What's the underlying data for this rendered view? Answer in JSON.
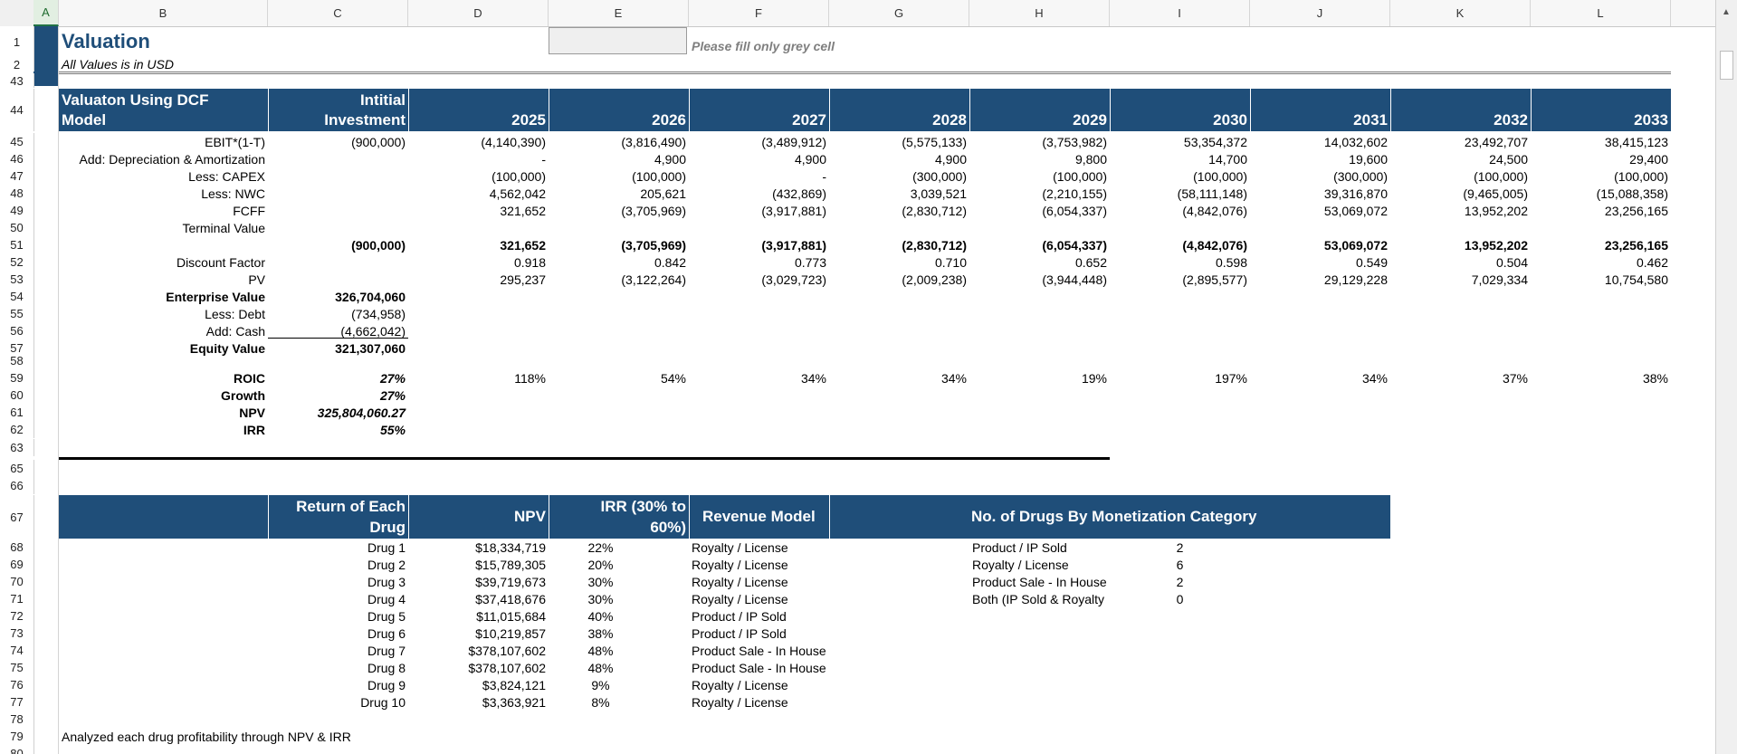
{
  "spreadsheet": {
    "columns": [
      "A",
      "B",
      "C",
      "D",
      "E",
      "F",
      "G",
      "H",
      "I",
      "J",
      "K",
      "L"
    ],
    "selected_column": "A",
    "title": "Valuation",
    "subtitle": "All Values is in USD",
    "note": "Please fill only grey cell",
    "dcf_header": {
      "label_line1": "Valuaton Using DCF",
      "label_line2": "Model",
      "initial_line1": "Intitial",
      "initial_line2": "Investment",
      "years": [
        "2025",
        "2026",
        "2027",
        "2028",
        "2029",
        "2030",
        "2031",
        "2032",
        "2033"
      ]
    },
    "dcf_rows": [
      {
        "row": "45",
        "label": "EBIT*(1-T)",
        "initial": "(900,000)",
        "values": [
          "(4,140,390)",
          "(3,816,490)",
          "(3,489,912)",
          "(5,575,133)",
          "(3,753,982)",
          "53,354,372",
          "14,032,602",
          "23,492,707",
          "38,415,123"
        ]
      },
      {
        "row": "46",
        "label": "Add: Depreciation & Amortization",
        "initial": "",
        "values": [
          "-",
          "4,900",
          "4,900",
          "4,900",
          "9,800",
          "14,700",
          "19,600",
          "24,500",
          "29,400"
        ]
      },
      {
        "row": "47",
        "label": "Less: CAPEX",
        "initial": "",
        "values": [
          "(100,000)",
          "(100,000)",
          "-",
          "(300,000)",
          "(100,000)",
          "(100,000)",
          "(300,000)",
          "(100,000)",
          "(100,000)"
        ]
      },
      {
        "row": "48",
        "label": "Less: NWC",
        "initial": "",
        "values": [
          "4,562,042",
          "205,621",
          "(432,869)",
          "3,039,521",
          "(2,210,155)",
          "(58,111,148)",
          "39,316,870",
          "(9,465,005)",
          "(15,088,358)"
        ]
      },
      {
        "row": "49",
        "label": "FCFF",
        "initial": "",
        "values": [
          "321,652",
          "(3,705,969)",
          "(3,917,881)",
          "(2,830,712)",
          "(6,054,337)",
          "(4,842,076)",
          "53,069,072",
          "13,952,202",
          "23,256,165"
        ]
      },
      {
        "row": "50",
        "label": "Terminal Value",
        "initial": "",
        "values": [
          "",
          "",
          "",
          "",
          "",
          "",
          "",
          "",
          ""
        ]
      },
      {
        "row": "51",
        "label": "",
        "initial": "(900,000)",
        "values": [
          "321,652",
          "(3,705,969)",
          "(3,917,881)",
          "(2,830,712)",
          "(6,054,337)",
          "(4,842,076)",
          "53,069,072",
          "13,952,202",
          "23,256,165"
        ],
        "bold": true
      },
      {
        "row": "52",
        "label": "Discount Factor",
        "initial": "",
        "values": [
          "0.918",
          "0.842",
          "0.773",
          "0.710",
          "0.652",
          "0.598",
          "0.549",
          "0.504",
          "0.462"
        ]
      },
      {
        "row": "53",
        "label": "PV",
        "initial": "",
        "values": [
          "295,237",
          "(3,122,264)",
          "(3,029,723)",
          "(2,009,238)",
          "(3,944,448)",
          "(2,895,577)",
          "29,129,228",
          "7,029,334",
          "10,754,580"
        ]
      }
    ],
    "valuation_rows": [
      {
        "row": "54",
        "label": "Enterprise Value",
        "value": "326,704,060",
        "bold": true
      },
      {
        "row": "55",
        "label": "Less: Debt",
        "value": "(734,958)",
        "bold": false
      },
      {
        "row": "56",
        "label": "Add: Cash",
        "value": "(4,662,042)",
        "bold": false
      },
      {
        "row": "57",
        "label": "Equity Value",
        "value": "321,307,060",
        "bold": true
      }
    ],
    "roic": {
      "row": "59",
      "label": "ROIC",
      "value": "27%",
      "years": [
        "118%",
        "54%",
        "34%",
        "34%",
        "19%",
        "197%",
        "34%",
        "37%",
        "38%"
      ]
    },
    "metrics": [
      {
        "row": "60",
        "label": "Growth",
        "value": "27%"
      },
      {
        "row": "61",
        "label": "NPV",
        "value": "325,804,060.27"
      },
      {
        "row": "62",
        "label": "IRR",
        "value": "55%"
      }
    ],
    "drug_header": {
      "return_line1": "Return of Each",
      "return_line2": "Drug",
      "npv": "NPV",
      "irr_line1": "IRR (30% to",
      "irr_line2": "60%)",
      "revenue_model": "Revenue Model",
      "monetization": "No. of Drugs By Monetization Category"
    },
    "drugs": [
      {
        "row": "68",
        "name": "Drug 1",
        "npv": "$18,334,719",
        "irr": "22%",
        "model": "Royalty / License"
      },
      {
        "row": "69",
        "name": "Drug 2",
        "npv": "$15,789,305",
        "irr": "20%",
        "model": "Royalty / License"
      },
      {
        "row": "70",
        "name": "Drug 3",
        "npv": "$39,719,673",
        "irr": "30%",
        "model": "Royalty / License"
      },
      {
        "row": "71",
        "name": "Drug 4",
        "npv": "$37,418,676",
        "irr": "30%",
        "model": "Royalty / License"
      },
      {
        "row": "72",
        "name": "Drug 5",
        "npv": "$11,015,684",
        "irr": "40%",
        "model": "Product / IP Sold"
      },
      {
        "row": "73",
        "name": "Drug 6",
        "npv": "$10,219,857",
        "irr": "38%",
        "model": "Product / IP Sold"
      },
      {
        "row": "74",
        "name": "Drug 7",
        "npv": "$378,107,602",
        "irr": "48%",
        "model": "Product Sale - In House"
      },
      {
        "row": "75",
        "name": "Drug 8",
        "npv": "$378,107,602",
        "irr": "48%",
        "model": "Product Sale - In House"
      },
      {
        "row": "76",
        "name": "Drug 9",
        "npv": "$3,824,121",
        "irr": "9%",
        "model": "Royalty / License"
      },
      {
        "row": "77",
        "name": "Drug 10",
        "npv": "$3,363,921",
        "irr": "8%",
        "model": "Royalty / License"
      }
    ],
    "categories": [
      {
        "label": "Product / IP Sold",
        "count": "2"
      },
      {
        "label": "Royalty / License",
        "count": "6"
      },
      {
        "label": "Product Sale - In House",
        "count": "2"
      },
      {
        "label": "Both (IP Sold & Royalty",
        "count": "0"
      }
    ],
    "footer_text": "Analyzed each drug profitability through NPV & IRR",
    "row_numbers": {
      "r1": "1",
      "r2": "2",
      "r43": "43",
      "r44": "44",
      "r50": "50",
      "r58": "58",
      "r63": "63",
      "r65": "65",
      "r66": "66",
      "r67": "67",
      "r78": "78",
      "r79": "79",
      "r80": "80"
    }
  }
}
